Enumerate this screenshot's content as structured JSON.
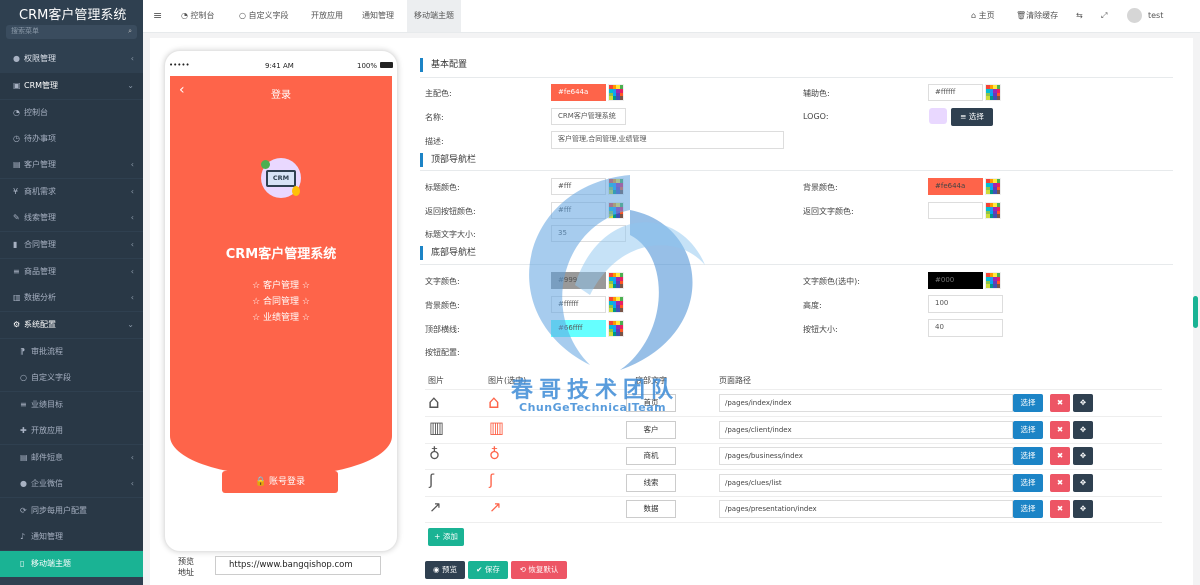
{
  "app": {
    "title": "CRM客户管理系统",
    "search_placeholder": "搜索菜单"
  },
  "sidebar": {
    "items": [
      {
        "label": "权限管理",
        "icon": "users-icon"
      },
      {
        "label": "CRM管理",
        "icon": "id-card-icon"
      },
      {
        "label": "控制台",
        "icon": "dashboard-icon"
      },
      {
        "label": "待办事项",
        "icon": "clock-icon"
      },
      {
        "label": "客户管理",
        "icon": "user-list-icon"
      },
      {
        "label": "商机需求",
        "icon": "yen-icon"
      },
      {
        "label": "线索管理",
        "icon": "wrench-icon"
      },
      {
        "label": "合同管理",
        "icon": "bookmark-icon"
      },
      {
        "label": "商品管理",
        "icon": "list-icon"
      },
      {
        "label": "数据分析",
        "icon": "bar-chart-icon"
      },
      {
        "label": "系统配置",
        "icon": "cogs-icon"
      },
      {
        "label": "审批流程",
        "icon": "flow-icon"
      },
      {
        "label": "自定义字段",
        "icon": "circle-icon"
      },
      {
        "label": "业绩目标",
        "icon": "target-icon"
      },
      {
        "label": "开放应用",
        "icon": "plug-icon"
      },
      {
        "label": "邮件短息",
        "icon": "mail-icon"
      },
      {
        "label": "企业微信",
        "icon": "wechat-icon"
      },
      {
        "label": "同步每用户配置",
        "icon": "sync-icon"
      },
      {
        "label": "通知管理",
        "icon": "bell-icon"
      },
      {
        "label": "移动端主题",
        "icon": "mobile-icon"
      }
    ]
  },
  "topbar": {
    "tabs": [
      "控制台",
      "自定义字段",
      "开放应用",
      "通知管理",
      "移动端主题"
    ],
    "home": "主页",
    "clear_cache": "清除缓存",
    "user": "test"
  },
  "phone": {
    "time": "9:41 AM",
    "signal": "•••••",
    "battery": "100%",
    "nav_title": "登录",
    "logo_text": "CRM",
    "app_name": "CRM客户管理系统",
    "features": [
      "☆ 客户管理 ☆",
      "☆ 合同管理 ☆",
      "☆ 业绩管理 ☆"
    ],
    "login_button": "账号登录"
  },
  "preview": {
    "label": "预览\n地址",
    "url": "https://www.bangqishop.com"
  },
  "basic": {
    "section": "基本配置",
    "primary_color_label": "主配色:",
    "primary_color": "#fe644a",
    "aux_color_label": "辅助色:",
    "aux_color": "#ffffff",
    "name_label": "名称:",
    "name": "CRM客户管理系统",
    "logo_label": "LOGO:",
    "logo_btn": "选择",
    "desc_label": "描述:",
    "desc": "客户管理,合同管理,业绩管理"
  },
  "topnav": {
    "section": "顶部导航栏",
    "title_color_label": "标题颜色:",
    "title_color": "#fff",
    "bg_color_label": "背景颜色:",
    "bg_color": "#fe644a",
    "back_btn_color_label": "返回按钮颜色:",
    "back_btn_color": "#fff",
    "back_text_color_label": "返回文字颜色:",
    "back_text_color": "",
    "title_size_label": "标题文字大小:",
    "title_size": "35"
  },
  "bottomnav": {
    "section": "底部导航栏",
    "text_color_label": "文字颜色:",
    "text_color": "#999",
    "text_color_sel_label": "文字颜色(选中):",
    "text_color_sel": "#000",
    "bg_color_label": "背景颜色:",
    "bg_color": "#ffffff",
    "height_label": "高度:",
    "height": "100",
    "top_border_label": "顶部横线:",
    "top_border": "#66ffff",
    "btn_size_label": "按钮大小:",
    "btn_size": "40",
    "btn_config_label": "按钮配置:",
    "headers": [
      "图片",
      "图片(选中)",
      "底部文字",
      "页面路径"
    ],
    "rows": [
      {
        "icon": "home-icon",
        "text": "首页",
        "path": "/pages/index/index"
      },
      {
        "icon": "building-icon",
        "text": "客户",
        "path": "/pages/client/index"
      },
      {
        "icon": "money-bag-icon",
        "text": "商机",
        "path": "/pages/business/index"
      },
      {
        "icon": "route-icon",
        "text": "线索",
        "path": "/pages/clues/list"
      },
      {
        "icon": "trend-chart-icon",
        "text": "数据",
        "path": "/pages/presentation/index"
      }
    ],
    "select_btn": "选择",
    "add_btn": "+ 添加"
  },
  "actions": {
    "preview": "预览",
    "save": "保存",
    "reset": "恢复默认"
  },
  "watermark": {
    "cn": "春哥技术团队",
    "en": "ChunGeTechnicalTeam"
  },
  "colors": {
    "primary": "#fe644a",
    "sidebar": "#2f4050",
    "accent": "#1ab394",
    "blue": "#1c84c6",
    "red": "#ed5565"
  }
}
